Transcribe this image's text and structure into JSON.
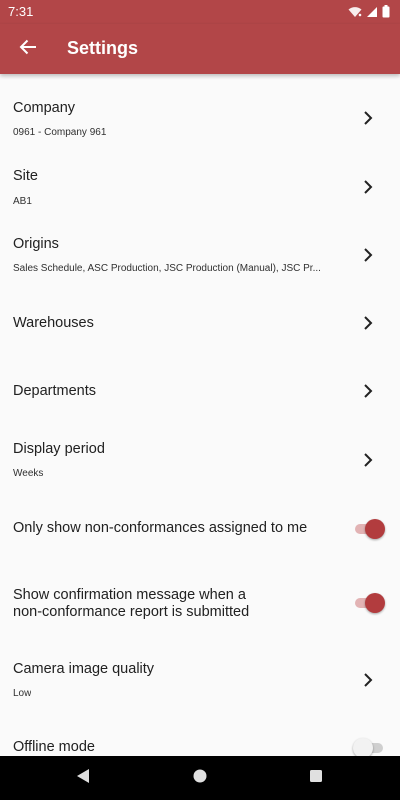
{
  "status_bar": {
    "time": "7:31",
    "icons": [
      "wifi-icon",
      "signal-icon",
      "battery-icon"
    ]
  },
  "app_bar": {
    "title": "Settings",
    "back_icon": "arrow-back-icon",
    "background_color": "#b24648"
  },
  "settings": {
    "company": {
      "title": "Company",
      "value": "0961  -  Company 961"
    },
    "site": {
      "title": "Site",
      "value": "AB1"
    },
    "origins": {
      "title": "Origins",
      "value": "Sales Schedule, ASC Production, JSC Production (Manual), JSC Pr..."
    },
    "warehouses": {
      "title": "Warehouses"
    },
    "departments": {
      "title": "Departments"
    },
    "display_period": {
      "title": "Display period",
      "value": "Weeks"
    },
    "only_assigned": {
      "title": "Only show non-conformances assigned to me",
      "enabled": true
    },
    "show_confirmation": {
      "title_line1": "Show confirmation message when a",
      "title_line2": "non-conformance report is submitted",
      "enabled": true
    },
    "camera_quality": {
      "title": "Camera image quality",
      "value": "Low"
    },
    "offline_mode": {
      "title": "Offline mode",
      "enabled": false
    }
  },
  "nav_bar": {
    "buttons": [
      "back-triangle-icon",
      "home-circle-icon",
      "recents-square-icon"
    ]
  },
  "colors": {
    "accent": "#b23c3e",
    "toggle_track_on": "#e2b3b4"
  }
}
